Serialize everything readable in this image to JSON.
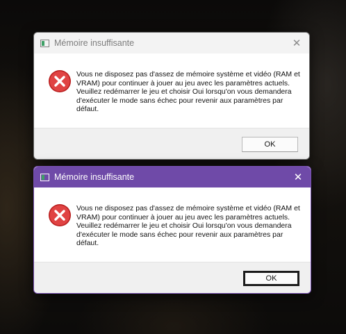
{
  "dialogs": [
    {
      "title": "Mémoire insuffisante",
      "close_glyph": "✕",
      "message": "Vous ne disposez pas d'assez de mémoire système et vidéo (RAM et VRAM) pour continuer à jouer au jeu avec les paramètres actuels. Veuillez redémarrer le jeu et choisir Oui lorsqu'on vous demandera d'exécuter le mode sans échec pour revenir aux paramètres par défaut.",
      "ok_label": "OK",
      "state": "inactive"
    },
    {
      "title": "Mémoire insuffisante",
      "close_glyph": "✕",
      "message": "Vous ne disposez pas d'assez de mémoire système et vidéo (RAM et VRAM) pour continuer à jouer au jeu avec les paramètres actuels. Veuillez redémarrer le jeu et choisir Oui lorsqu'on vous demandera d'exécuter le mode sans échec pour revenir aux paramètres par défaut.",
      "ok_label": "OK",
      "state": "active"
    }
  ],
  "icons": {
    "error": "error-icon",
    "app": "app-window-icon",
    "close": "close-icon"
  },
  "colors": {
    "active_titlebar": "#6f4aa8",
    "inactive_titlebar": "#f3f3f3",
    "error_red": "#d9302f"
  }
}
